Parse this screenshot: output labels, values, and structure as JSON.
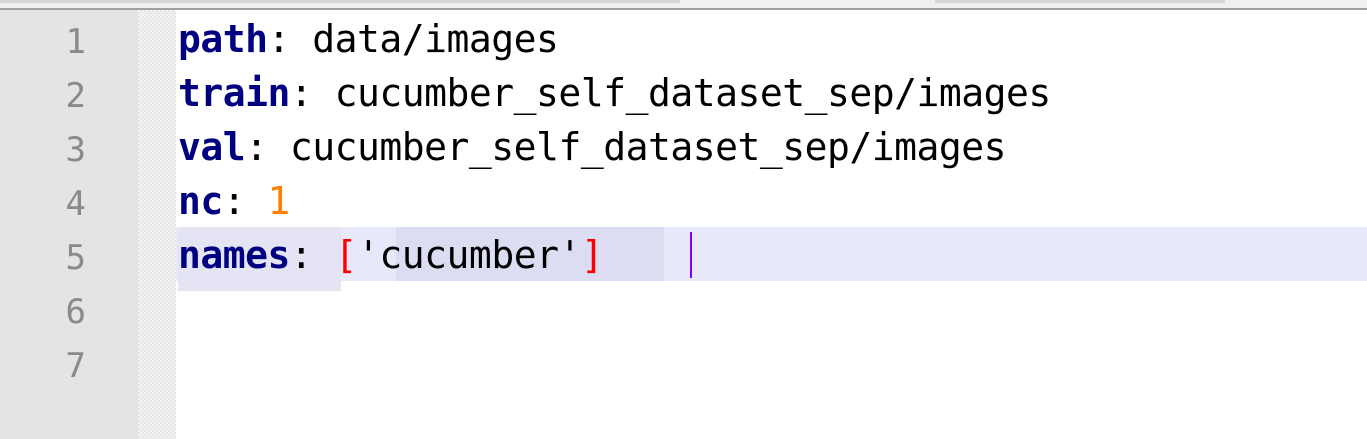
{
  "editor": {
    "line_numbers": [
      "1",
      "2",
      "3",
      "4",
      "5",
      "6",
      "7"
    ],
    "lines": [
      {
        "key": "path",
        "colon": ": ",
        "value": "data/images"
      },
      {
        "key": "train",
        "colon": ": ",
        "value": "cucumber_self_dataset_sep/images"
      },
      {
        "key": "val",
        "colon": ": ",
        "value": "cucumber_self_dataset_sep/images"
      },
      {
        "key": "nc",
        "colon": ": ",
        "value": "1"
      },
      {
        "key": "names",
        "colon": ": ",
        "open_bracket": "[",
        "value": "'cucumber'",
        "close_bracket": "]"
      }
    ],
    "current_line": "5"
  },
  "colors": {
    "key": "#000080",
    "number": "#ff8000",
    "bracket": "#ff0000",
    "current_line_highlight": "#e8e8fb",
    "caret": "#8000ff"
  }
}
